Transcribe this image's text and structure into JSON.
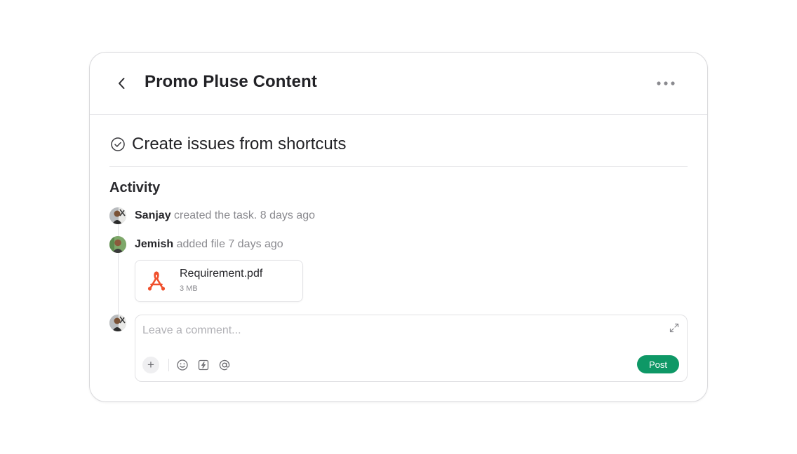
{
  "header": {
    "title": "Promo Pluse Content",
    "back_icon": "chevron-left-icon",
    "more_icon": "more-horizontal-icon"
  },
  "task": {
    "title": "Create issues from shortcuts",
    "status_icon": "check-circle-icon"
  },
  "activity": {
    "heading": "Activity",
    "items": [
      {
        "user": "Sanjay",
        "action": " created the task. 8 days ago"
      },
      {
        "user": "Jemish",
        "action": " added file 7 days ago"
      }
    ],
    "attachment": {
      "name": "Requirement.pdf",
      "size": "3 MB",
      "icon": "pdf-icon",
      "accent": "#f0502c"
    }
  },
  "comment": {
    "placeholder": "Leave a comment...",
    "value": "",
    "post_label": "Post",
    "post_color": "#0e9866",
    "tools": [
      "plus-icon",
      "emoji-icon",
      "lightning-icon",
      "mention-icon"
    ]
  }
}
